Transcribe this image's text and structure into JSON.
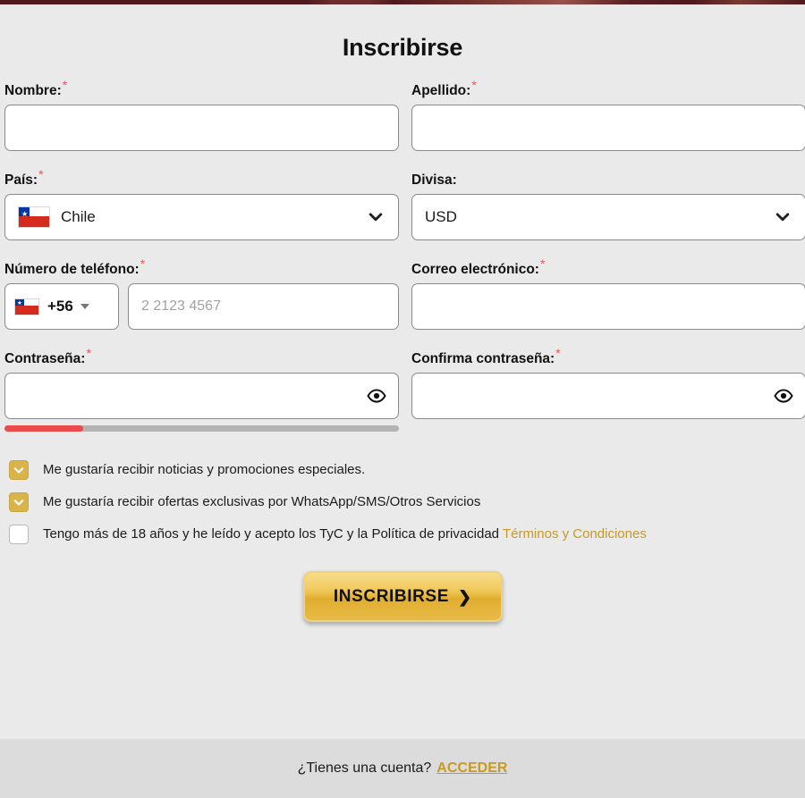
{
  "page": {
    "title": "Inscribirse"
  },
  "fields": {
    "nombre": {
      "label": "Nombre:",
      "required": true,
      "value": "",
      "placeholder": ""
    },
    "apellido": {
      "label": "Apellido:",
      "required": true,
      "value": "",
      "placeholder": ""
    },
    "pais": {
      "label": "País:",
      "required": true,
      "value": "Chile",
      "flag": "chile-flag-icon"
    },
    "divisa": {
      "label": "Divisa:",
      "required": false,
      "value": "USD"
    },
    "telefono": {
      "label": "Número de teléfono:",
      "required": true,
      "prefix": "+56",
      "flag": "chile-flag-icon",
      "value": "",
      "placeholder": "2 2123 4567"
    },
    "correo": {
      "label": "Correo electrónico:",
      "required": true,
      "value": "",
      "placeholder": ""
    },
    "contrasena": {
      "label": "Contraseña:",
      "required": true,
      "value": "",
      "placeholder": "",
      "strength_percent": 20,
      "strength_color": "#ea4b4b"
    },
    "confirma_contrasena": {
      "label": "Confirma contraseña:",
      "required": true,
      "value": "",
      "placeholder": ""
    }
  },
  "checkboxes": [
    {
      "label": "Me gustaría recibir noticias y promociones especiales.",
      "checked": true
    },
    {
      "label": "Me gustaría recibir ofertas exclusivas por WhatsApp/SMS/Otros Servicios",
      "checked": true
    },
    {
      "label": "Tengo más de 18 años y he leído y acepto los TyC y la Política de privacidad",
      "checked": false,
      "link_text": "Términos y Condiciones"
    }
  ],
  "submit": {
    "label": "INSCRIBIRSE",
    "arrow": "❯"
  },
  "footer": {
    "text": "¿Tienes una cuenta?",
    "link": "ACCEDER"
  },
  "colors": {
    "background": "#eaeaea",
    "footer_background": "#dcdcdc",
    "accent_gold": "#c79a25",
    "checkbox_gold": "#d8b44a",
    "required_asterisk": "#e2585c",
    "strength_red": "#ea4b4b",
    "header_strip": "#5c1f22"
  }
}
